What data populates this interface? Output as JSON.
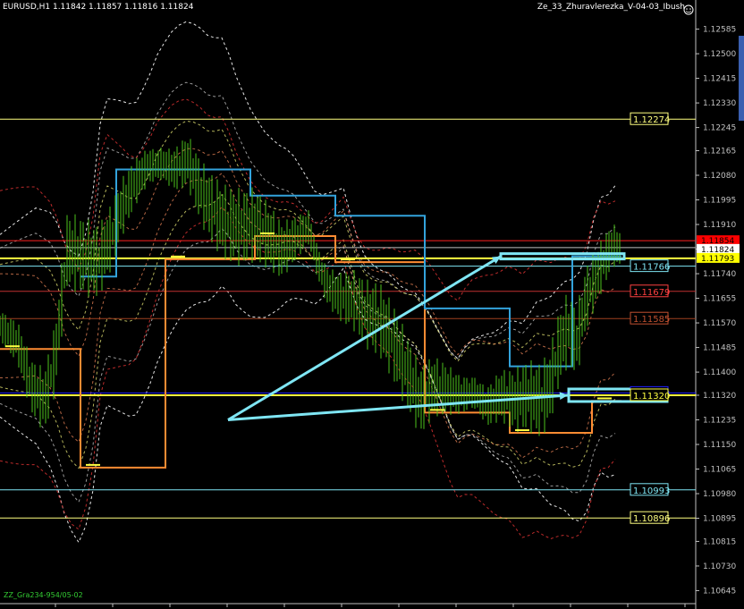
{
  "header": {
    "symbol_info": "EURUSD,H1  1.11842 1.11857 1.11816 1.11824",
    "indicator_name": "Ze_33_Zhuravlerezka_V-04-03_Ibush",
    "smiley_icon": "smiley-icon"
  },
  "footer": {
    "overlay_text": "ZZ_Gra234-954/05-02"
  },
  "colors": {
    "background": "#000000",
    "axis": "#c0c0c0",
    "candle": "#4dc21b",
    "yellow_level": "#ffff80",
    "red_level": "#ff2020",
    "cyan": "#7fe6f4",
    "blue_level": "#2020ff",
    "orange_step": "#ff8c33",
    "sky_step": "#33a3dc"
  },
  "chart_data": {
    "type": "line",
    "symbol": "EURUSD",
    "timeframe": "H1",
    "ohlc_last": {
      "open": 1.11842,
      "high": 1.11857,
      "low": 1.11816,
      "close": 1.11824
    },
    "ylim": [
      1.106,
      1.1263
    ],
    "y_ticks": [
      "1.12585",
      "1.12500",
      "1.12415",
      "1.12330",
      "1.12245",
      "1.12165",
      "1.12080",
      "1.11995",
      "1.11910",
      "1.11825",
      "1.11740",
      "1.11655",
      "1.11570",
      "1.11485",
      "1.11400",
      "1.11320",
      "1.11235",
      "1.11150",
      "1.11065",
      "1.10980",
      "1.10895",
      "1.10815",
      "1.10730",
      "1.10645",
      "1.10560"
    ],
    "y_tick_values": [
      1.12585,
      1.125,
      1.12415,
      1.1233,
      1.12245,
      1.12165,
      1.1208,
      1.11995,
      1.1191,
      1.11825,
      1.1174,
      1.11655,
      1.1157,
      1.11485,
      1.114,
      1.1132,
      1.11235,
      1.1115,
      1.11065,
      1.1098,
      1.10895,
      1.10815,
      1.1073,
      1.10645,
      1.1056
    ],
    "y_tick_labels": [
      "1.12585",
      "1.12500",
      "1.12415",
      "1.12330",
      "1.12245",
      "1.12165",
      "1.12080",
      "1.11995",
      "1.11910",
      "1.11825",
      "1.11740",
      "1.11655",
      "1.11570",
      "1.11485",
      "1.11400",
      "1.11320",
      "1.11235",
      "1.11150",
      "1.11065",
      "1.10980",
      "1.10895",
      "1.10815",
      "1.10730",
      "1.10645",
      "1.10560"
    ],
    "price_labels": [
      {
        "value": 1.12274,
        "text": "1.12274",
        "color": "#ffff80",
        "scale_label": false
      },
      {
        "value": 1.11766,
        "text": "1.11766",
        "color": "#7fe6f4",
        "scale_label": false
      },
      {
        "value": 1.11679,
        "text": "1.11679",
        "color": "#ff4040",
        "scale_label": false
      },
      {
        "value": 1.11585,
        "text": "1.11585",
        "color": "#c05030",
        "scale_label": false
      },
      {
        "value": 1.11328,
        "text": "1.11328",
        "color": "#2020ff",
        "scale_label": false
      },
      {
        "value": 1.1132,
        "text": "1.11320",
        "color": "#ffff40",
        "scale_label": false
      },
      {
        "value": 1.10993,
        "text": "1.10993",
        "color": "#7fe6f4",
        "scale_label": false
      },
      {
        "value": 1.10896,
        "text": "1.10896",
        "color": "#ffff80",
        "scale_label": false
      }
    ],
    "scale_markers": [
      {
        "value": 1.11854,
        "text": "1.11854",
        "bg": "#ff0000",
        "fg": "#000000"
      },
      {
        "value": 1.11824,
        "text": "1.11824",
        "bg": "#ffffff",
        "fg": "#000000"
      },
      {
        "value": 1.11793,
        "text": "1.11793",
        "bg": "#ffff00",
        "fg": "#000000"
      }
    ],
    "levels": [
      {
        "value": 1.12274,
        "color": "#ffff80",
        "width": 1
      },
      {
        "value": 1.11854,
        "color": "#ff2020",
        "width": 1
      },
      {
        "value": 1.1183,
        "color": "#c0c0c0",
        "width": 1
      },
      {
        "value": 1.11793,
        "color": "#ffff40",
        "width": 2
      },
      {
        "value": 1.11766,
        "color": "#7fe6f4",
        "width": 1
      },
      {
        "value": 1.11679,
        "color": "#c03030",
        "width": 1
      },
      {
        "value": 1.11585,
        "color": "#a04020",
        "width": 1
      },
      {
        "value": 1.11328,
        "color": "#2020ff",
        "width": 1
      },
      {
        "value": 1.1132,
        "color": "#ffff40",
        "width": 2
      },
      {
        "value": 1.10993,
        "color": "#7fe6f4",
        "width": 1
      },
      {
        "value": 1.10896,
        "color": "#ffff80",
        "width": 1
      }
    ],
    "price_path": [
      [
        0,
        1.1156
      ],
      [
        20,
        1.115
      ],
      [
        35,
        1.1135
      ],
      [
        50,
        1.113
      ],
      [
        62,
        1.1145
      ],
      [
        75,
        1.1182
      ],
      [
        95,
        1.118
      ],
      [
        110,
        1.1178
      ],
      [
        125,
        1.1187
      ],
      [
        135,
        1.1196
      ],
      [
        150,
        1.1205
      ],
      [
        165,
        1.1211
      ],
      [
        180,
        1.1212
      ],
      [
        195,
        1.121
      ],
      [
        210,
        1.1213
      ],
      [
        225,
        1.1202
      ],
      [
        240,
        1.1195
      ],
      [
        255,
        1.1191
      ],
      [
        270,
        1.119
      ],
      [
        285,
        1.1191
      ],
      [
        300,
        1.1187
      ],
      [
        315,
        1.1182
      ],
      [
        330,
        1.1186
      ],
      [
        345,
        1.119
      ],
      [
        355,
        1.1178
      ],
      [
        365,
        1.117
      ],
      [
        380,
        1.1166
      ],
      [
        395,
        1.1165
      ],
      [
        410,
        1.116
      ],
      [
        425,
        1.1158
      ],
      [
        440,
        1.115
      ],
      [
        455,
        1.114
      ],
      [
        470,
        1.113
      ],
      [
        485,
        1.1135
      ],
      [
        500,
        1.1134
      ],
      [
        515,
        1.1132
      ],
      [
        530,
        1.1133
      ],
      [
        545,
        1.1128
      ],
      [
        560,
        1.1132
      ],
      [
        575,
        1.113
      ],
      [
        590,
        1.1132
      ],
      [
        605,
        1.113
      ],
      [
        615,
        1.1135
      ],
      [
        625,
        1.1148
      ],
      [
        635,
        1.1155
      ],
      [
        645,
        1.115
      ],
      [
        655,
        1.1165
      ],
      [
        665,
        1.1172
      ],
      [
        675,
        1.1178
      ],
      [
        685,
        1.1184
      ],
      [
        695,
        1.11824
      ]
    ],
    "orange_step": [
      [
        0,
        1.1148
      ],
      [
        90,
        1.1148
      ],
      [
        90,
        1.1107
      ],
      [
        185,
        1.1107
      ],
      [
        185,
        1.1179
      ],
      [
        285,
        1.1179
      ],
      [
        285,
        1.1187
      ],
      [
        375,
        1.1187
      ],
      [
        375,
        1.1178
      ],
      [
        475,
        1.1178
      ],
      [
        475,
        1.1126
      ],
      [
        570,
        1.1126
      ],
      [
        570,
        1.1119
      ],
      [
        662,
        1.1119
      ],
      [
        662,
        1.113
      ],
      [
        695,
        1.113
      ]
    ],
    "sky_step": [
      [
        90,
        1.1173
      ],
      [
        130,
        1.1173
      ],
      [
        130,
        1.121
      ],
      [
        280,
        1.121
      ],
      [
        280,
        1.1201
      ],
      [
        375,
        1.1201
      ],
      [
        375,
        1.1194
      ],
      [
        475,
        1.1194
      ],
      [
        475,
        1.1162
      ],
      [
        570,
        1.1162
      ],
      [
        570,
        1.1142
      ],
      [
        640,
        1.1142
      ],
      [
        640,
        1.118
      ],
      [
        695,
        1.118
      ]
    ],
    "arrows": [
      {
        "from": [
          255,
          1.11235
        ],
        "to": [
          560,
          1.118
        ]
      },
      {
        "from": [
          255,
          1.11235
        ],
        "to": [
          635,
          1.1132
        ]
      }
    ]
  }
}
